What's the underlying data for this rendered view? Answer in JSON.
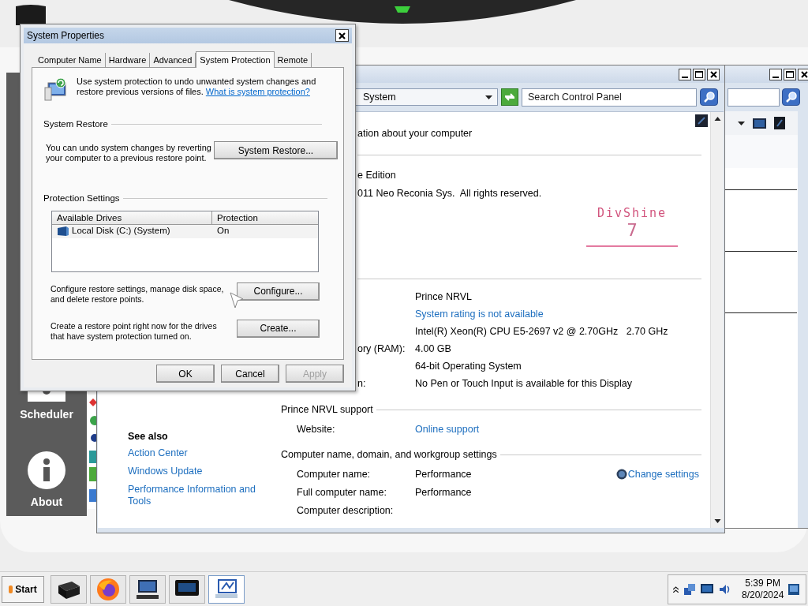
{
  "dialog": {
    "title": "System Properties",
    "tabs": [
      {
        "label": "Computer Name",
        "selected": false
      },
      {
        "label": "Hardware",
        "selected": false
      },
      {
        "label": "Advanced",
        "selected": false
      },
      {
        "label": "System Protection",
        "selected": true
      },
      {
        "label": "Remote",
        "selected": false
      }
    ],
    "intro": {
      "text": "Use system protection to undo unwanted system changes and restore previous versions of files.",
      "link": "What is system protection?"
    },
    "system_restore": {
      "heading": "System Restore",
      "text": "You can undo system changes by reverting your computer to a previous restore point.",
      "button": "System Restore..."
    },
    "protection_settings": {
      "heading": "Protection Settings",
      "columns": [
        "Available Drives",
        "Protection"
      ],
      "rows": [
        {
          "drive": "Local Disk (C:) (System)",
          "protection": "On"
        }
      ],
      "actions": [
        {
          "text": "Configure restore settings, manage disk space, and delete restore points.",
          "button": "Configure..."
        },
        {
          "text": "Create a restore point right now for the drives that have system protection turned on.",
          "button": "Create..."
        }
      ]
    },
    "buttons": [
      {
        "label": "OK",
        "disabled": false
      },
      {
        "label": "Cancel",
        "disabled": false
      },
      {
        "label": "Apply",
        "disabled": true
      }
    ]
  },
  "control_panel": {
    "address": "System",
    "search": {
      "placeholder": "Search Control Panel"
    },
    "description": "ation about your computer",
    "edition": "e Edition",
    "copyright": "011 Neo Reconia Sys.  All rights reserved.",
    "logo": {
      "name": "DivShine",
      "version": "7"
    },
    "system_rows": [
      {
        "value": "Prince NRVL",
        "kind": "text"
      },
      {
        "value": "System rating is not available",
        "kind": "link"
      },
      {
        "value": "Intel(R) Xeon(R) CPU E5-2697 v2 @ 2.70GHz   2.70 GHz",
        "kind": "text"
      },
      {
        "label": "ory (RAM):",
        "value": "4.00 GB",
        "kind": "text"
      },
      {
        "value": "64-bit Operating System",
        "kind": "text"
      },
      {
        "label": "n:",
        "value": "No Pen or Touch Input is available for this Display",
        "kind": "text"
      }
    ],
    "support": {
      "heading": "Prince NRVL support",
      "rows": [
        {
          "label": "Website:",
          "value": "Online support",
          "kind": "link"
        }
      ]
    },
    "computer_name": {
      "heading": "Computer name, domain, and workgroup settings",
      "change_link": "Change settings",
      "rows": [
        {
          "label": "Computer name:",
          "value": "Performance",
          "kind": "text"
        },
        {
          "label": "Full computer name:",
          "value": "Performance",
          "kind": "text"
        },
        {
          "label": "Computer description:"
        }
      ]
    },
    "see_also": {
      "heading": "See also",
      "links": [
        "Action Center",
        "Windows Update",
        "Performance Information and Tools"
      ]
    }
  },
  "side_panel": {
    "items": [
      {
        "label": "Scheduler",
        "kind": "scheduler"
      },
      {
        "label": "About",
        "kind": "about"
      }
    ]
  },
  "taskbar": {
    "start": "Start",
    "tasks": [
      {
        "kind": "drive",
        "selected": false
      },
      {
        "kind": "browser",
        "selected": false
      },
      {
        "kind": "computer",
        "selected": false
      },
      {
        "kind": "monitor",
        "selected": false
      },
      {
        "kind": "system",
        "selected": true
      }
    ],
    "clock": {
      "time": "5:39 PM",
      "date": "8/20/2024"
    }
  }
}
